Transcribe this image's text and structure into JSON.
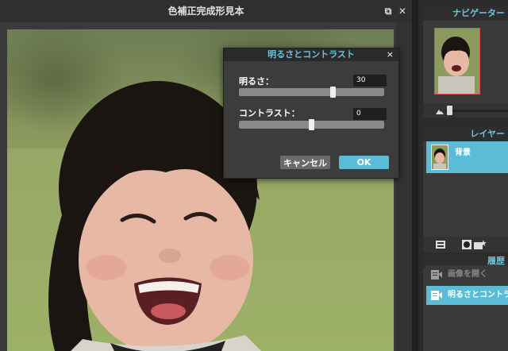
{
  "document": {
    "title": "色補正完成形見本",
    "restore_glyph": "⧉",
    "close_glyph": "✕"
  },
  "navigator": {
    "title": "ナビゲーター"
  },
  "layers": {
    "title": "レイヤー",
    "items": [
      {
        "label": "背景"
      }
    ]
  },
  "history": {
    "title": "履歴",
    "items": [
      {
        "label": "画像を開く",
        "active": false
      },
      {
        "label": "明るさとコントラスト",
        "active": true
      }
    ]
  },
  "dialog": {
    "title": "明るさとコントラスト",
    "close_glyph": "×",
    "brightness": {
      "label": "明るさ：",
      "value": "30",
      "fraction": 0.65
    },
    "contrast": {
      "label": "コントラスト：",
      "value": "0",
      "fraction": 0.5
    },
    "cancel_label": "キャンセル",
    "ok_label": "OK"
  },
  "colors": {
    "accent": "#5bbcd8",
    "panel_title": "#6cc3da",
    "background": "#2b2b2b"
  }
}
